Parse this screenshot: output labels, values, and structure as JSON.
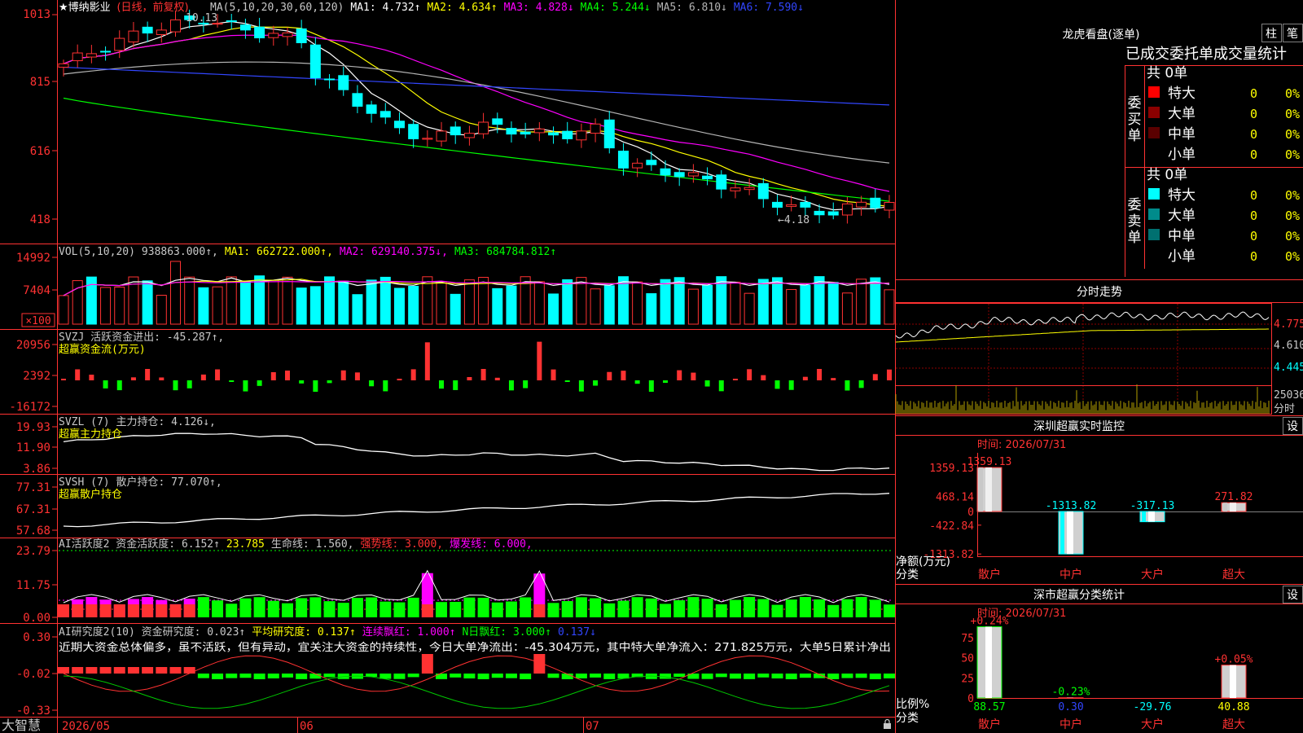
{
  "colors": {
    "up": "#ff3232",
    "down": "#00ffff",
    "ma1": "#ffffff",
    "ma2": "#ffff00",
    "ma3": "#ff00ff",
    "ma4": "#00ff00",
    "ma5": "#b4b4b4",
    "ma6": "#3246ff",
    "axis": "#ff3232",
    "grid": "#8b0000"
  },
  "app": {
    "brand": "大智慧",
    "status_icon": "lock-icon"
  },
  "price": {
    "title": "★博纳影业",
    "period": "(日线，前复权)",
    "legend": [
      {
        "text": "MA(5,10,20,30,60,120)",
        "color": "#c8c8c8"
      },
      {
        "text": "MA1: 4.732↑",
        "color": "#ffffff"
      },
      {
        "text": "MA2: 4.634↑",
        "color": "#ffff00"
      },
      {
        "text": "MA3: 4.828↓",
        "color": "#ff00ff"
      },
      {
        "text": "MA4: 5.244↓",
        "color": "#00ff00"
      },
      {
        "text": "MA5: 6.810↓",
        "color": "#b4b4b4"
      },
      {
        "text": "MA6: 7.590↓",
        "color": "#3246ff"
      }
    ],
    "ticks": [
      "1013",
      "815",
      "616",
      "418"
    ],
    "high_label": "10.13",
    "low_label": "←4.18"
  },
  "volume": {
    "legend": [
      {
        "text": "VOL(5,10,20)",
        "color": "#c8c8c8"
      },
      {
        "text": "938863.000↑,",
        "color": "#c8c8c8"
      },
      {
        "text": "MA1: 662722.000↑,",
        "color": "#ffff00"
      },
      {
        "text": "MA2: 629140.375↓,",
        "color": "#ff00ff"
      },
      {
        "text": "MA3: 684784.812↑",
        "color": "#00ff00"
      }
    ],
    "ticks": [
      "14992",
      "7404"
    ],
    "unit": "×100"
  },
  "svzj": {
    "legend": "SVZJ  活跃资金进出: -45.287↑,",
    "sub": "超赢资金流(万元)",
    "ticks": [
      "20956",
      "2392",
      "-16172"
    ]
  },
  "svzl": {
    "legend": "SVZL (7) 主力持仓: 4.126↓,",
    "sub": "超赢主力持仓",
    "ticks": [
      "19.93",
      "11.90",
      "3.86"
    ]
  },
  "svsh": {
    "legend": "SVSH (7) 散户持仓: 77.070↑,",
    "sub": "超赢散户持仓",
    "ticks": [
      "77.31",
      "67.31",
      "57.68"
    ]
  },
  "ai_active": {
    "legend": [
      {
        "text": "AI活跃度2 资金活跃度: 6.152↑",
        "color": "#c8c8c8"
      },
      {
        "text": "23.785",
        "color": "#ffff00"
      },
      {
        "text": "生命线: 1.560,",
        "color": "#c8c8c8"
      },
      {
        "text": "强势线: 3.000,",
        "color": "#ff3232"
      },
      {
        "text": "爆发线: 6.000,",
        "color": "#ff00ff"
      }
    ],
    "ticks": [
      "23.79",
      "11.75",
      "0.00"
    ]
  },
  "ai_research": {
    "legend": [
      {
        "text": "AI研究度2(10) 资金研究度: 0.023↑",
        "color": "#c8c8c8"
      },
      {
        "text": "平均研究度: 0.137↑",
        "color": "#ffff00"
      },
      {
        "text": "连续飘红: 1.000↑",
        "color": "#ff00ff"
      },
      {
        "text": "N日飘红: 3.000↑",
        "color": "#00ff00"
      },
      {
        "text": "0.137↓",
        "color": "#3246ff"
      }
    ],
    "comment": "近期大资金总体偏多，虽不活跃，但有异动，宜关注大资金的持续性，今日大单净流出：-45.304万元，其中特大单净流入：271.825万元，大单5日累计净出",
    "ticks": [
      "0.30",
      "-0.02",
      "-0.33"
    ]
  },
  "dates": [
    "2026/05",
    "06",
    "07"
  ],
  "dragon": {
    "title": "龙虎看盘(逐单)",
    "btn1": "柱",
    "btn2": "笔",
    "header": "已成交委托单成交量统计",
    "buy": {
      "side": "委买单",
      "total": "共 0单",
      "rows": [
        {
          "label": "特大",
          "count": "0",
          "pct": "0%",
          "color": "#ff0000"
        },
        {
          "label": "大单",
          "count": "0",
          "pct": "0%",
          "color": "#8b0000"
        },
        {
          "label": "中单",
          "count": "0",
          "pct": "0%",
          "color": "#5a0000"
        },
        {
          "label": "小单",
          "count": "0",
          "pct": "0%",
          "color": ""
        }
      ]
    },
    "sell": {
      "side": "委卖单",
      "total": "共 0单",
      "rows": [
        {
          "label": "特大",
          "count": "0",
          "pct": "0%",
          "color": "#00ffff"
        },
        {
          "label": "大单",
          "count": "0",
          "pct": "0%",
          "color": "#008b8b"
        },
        {
          "label": "中单",
          "count": "0",
          "pct": "0%",
          "color": "#007070"
        },
        {
          "label": "小单",
          "count": "0",
          "pct": "0%",
          "color": ""
        }
      ]
    }
  },
  "intraday": {
    "title": "分时走势",
    "ticks": [
      "4.775",
      "4.610",
      "4.445"
    ],
    "vol_label": "25036",
    "vol_unit": "分时"
  },
  "sz_monitor": {
    "title": "深圳超赢实时监控",
    "btn": "设",
    "time": "时间: 2026/07/31",
    "ticks": [
      "1359.13",
      "468.14",
      "0",
      "-422.84",
      "-1313.82"
    ],
    "ylabel": "净额(万元)",
    "xlabel": "分类",
    "categories": [
      "散户",
      "中户",
      "大户",
      "超大"
    ],
    "values": [
      1359.13,
      -1313.82,
      -317.13,
      271.82
    ],
    "value_labels": [
      "1359.13",
      "-1313.82",
      "-317.13",
      "271.82"
    ]
  },
  "sz_class": {
    "title": "深市超赢分类统计",
    "btn": "设",
    "time": "时间: 2026/07/31",
    "ticks": [
      "75",
      "50",
      "25",
      "0"
    ],
    "ylabel": "比例%",
    "xlabel": "分类",
    "categories": [
      "散户",
      "中户",
      "大户",
      "超大"
    ],
    "ratios": [
      88.57,
      0.3,
      -29.76,
      40.88
    ],
    "ratio_labels": [
      "88.57",
      "0.30",
      "-29.76",
      "40.88"
    ],
    "changes": [
      "+0.24%",
      "-0.23%",
      "",
      "+0.05%"
    ]
  }
}
